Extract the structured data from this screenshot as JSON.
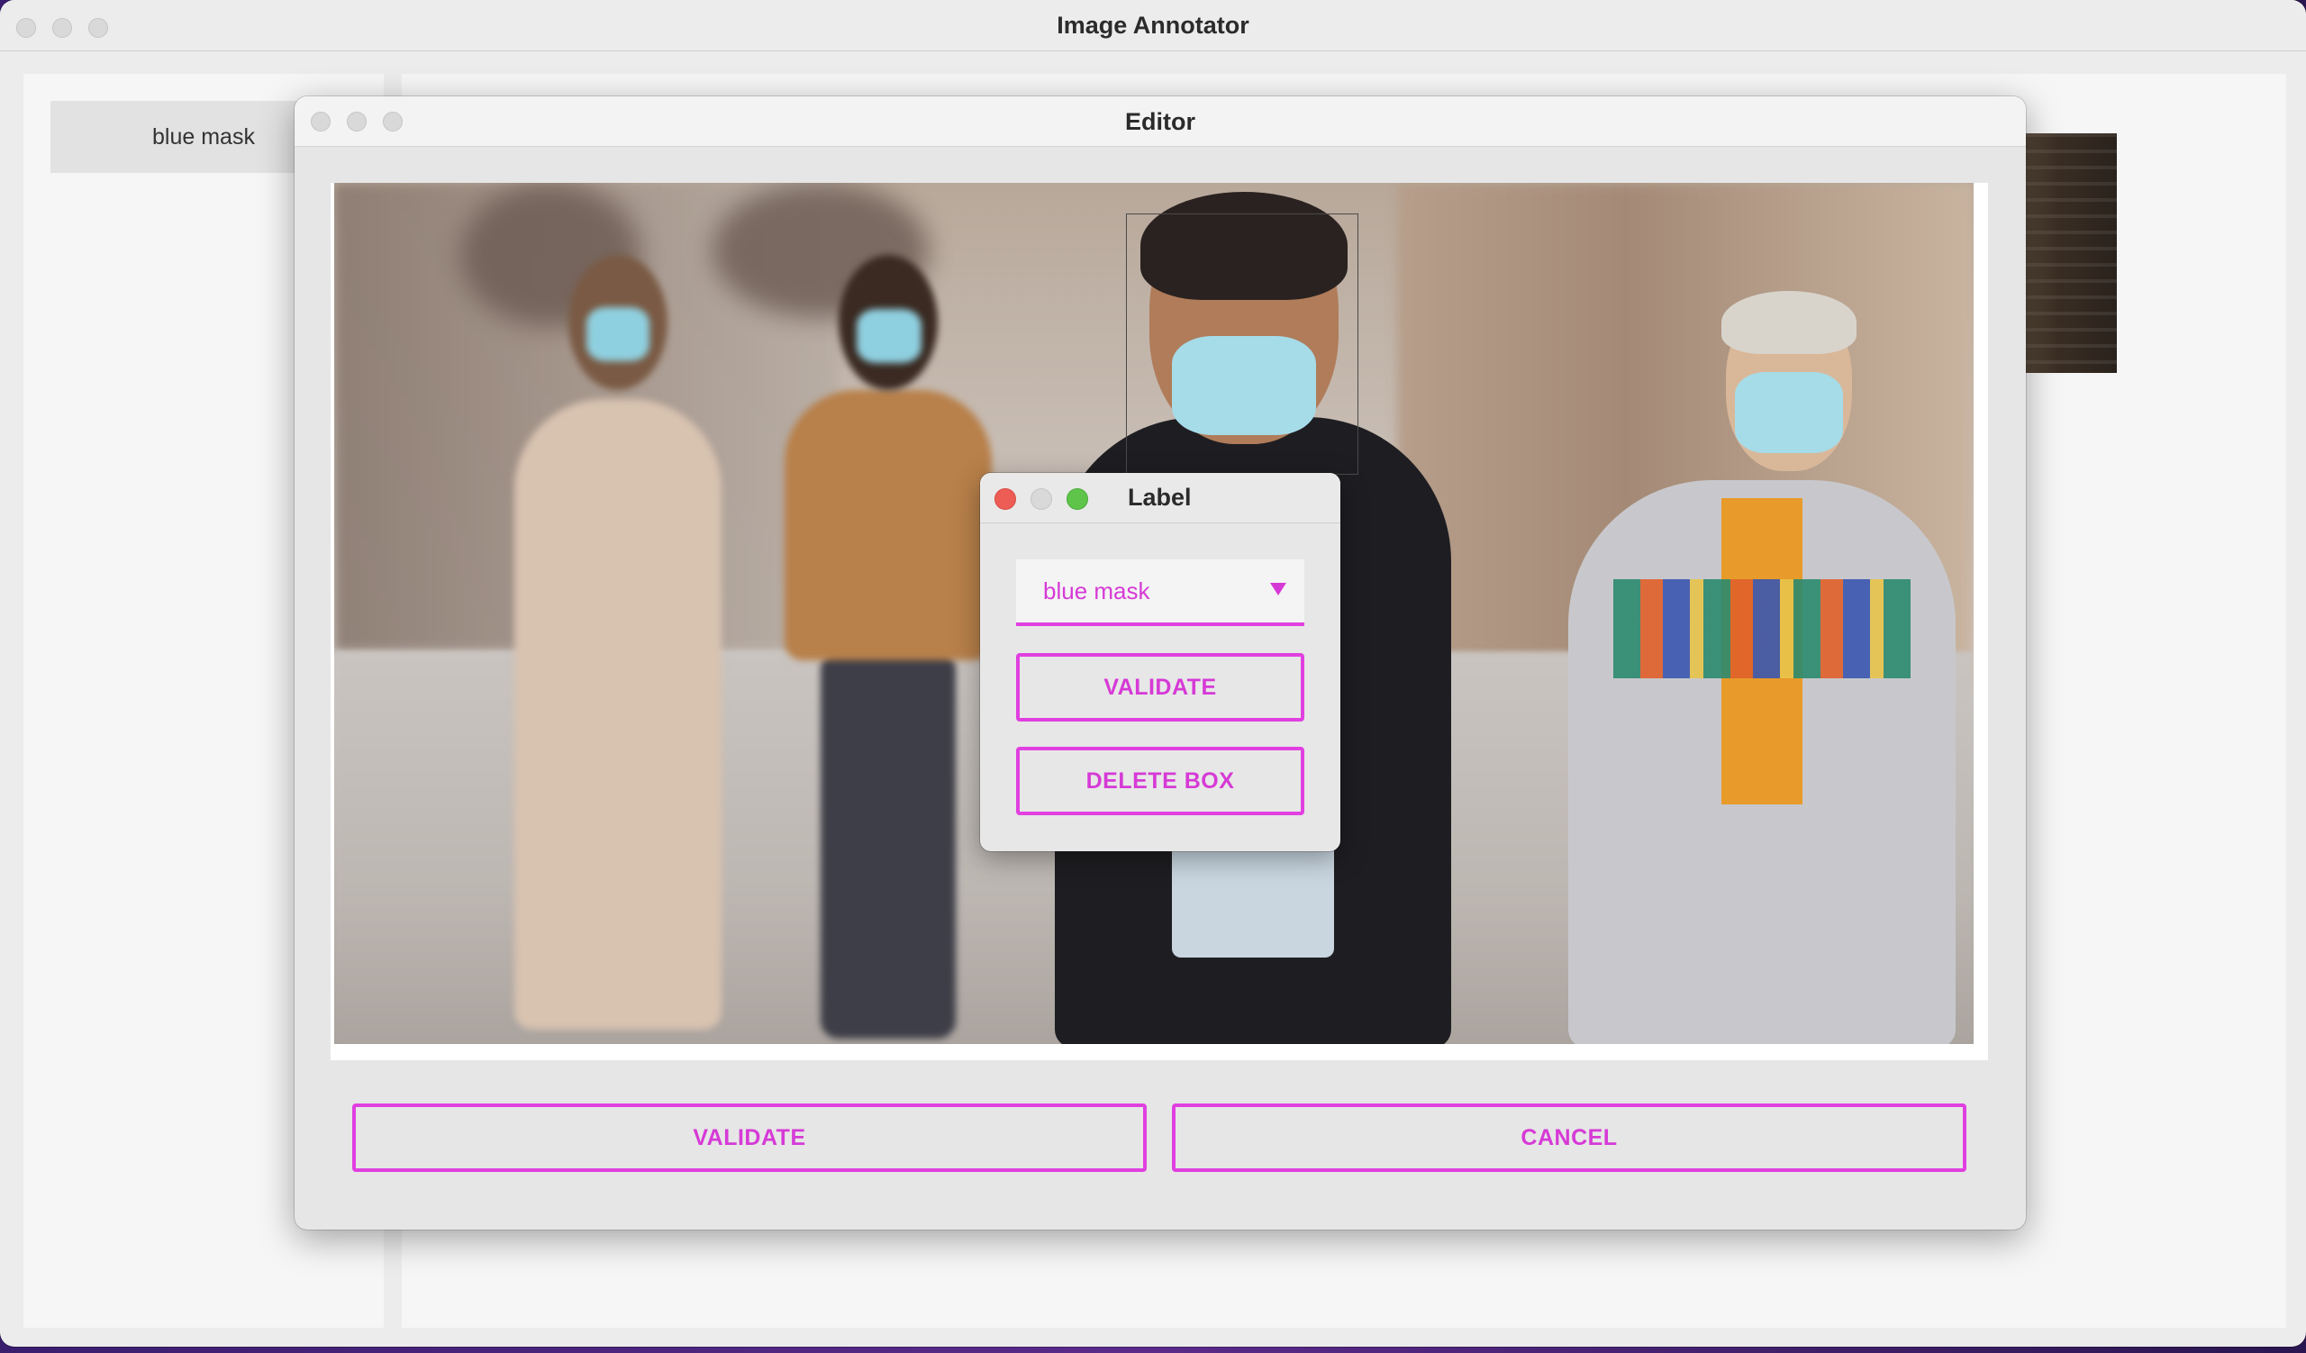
{
  "app": {
    "title": "Image Annotator"
  },
  "sidebar": {
    "items": [
      {
        "label": "blue mask"
      }
    ]
  },
  "editor": {
    "title": "Editor",
    "validate_label": "VALIDATE",
    "cancel_label": "CANCEL"
  },
  "label_dialog": {
    "title": "Label",
    "selected_label": "blue mask",
    "validate_label": "VALIDATE",
    "delete_label": "DELETE BOX"
  },
  "colors": {
    "accent": "#e040e0",
    "accent_text": "#d63ad6"
  }
}
